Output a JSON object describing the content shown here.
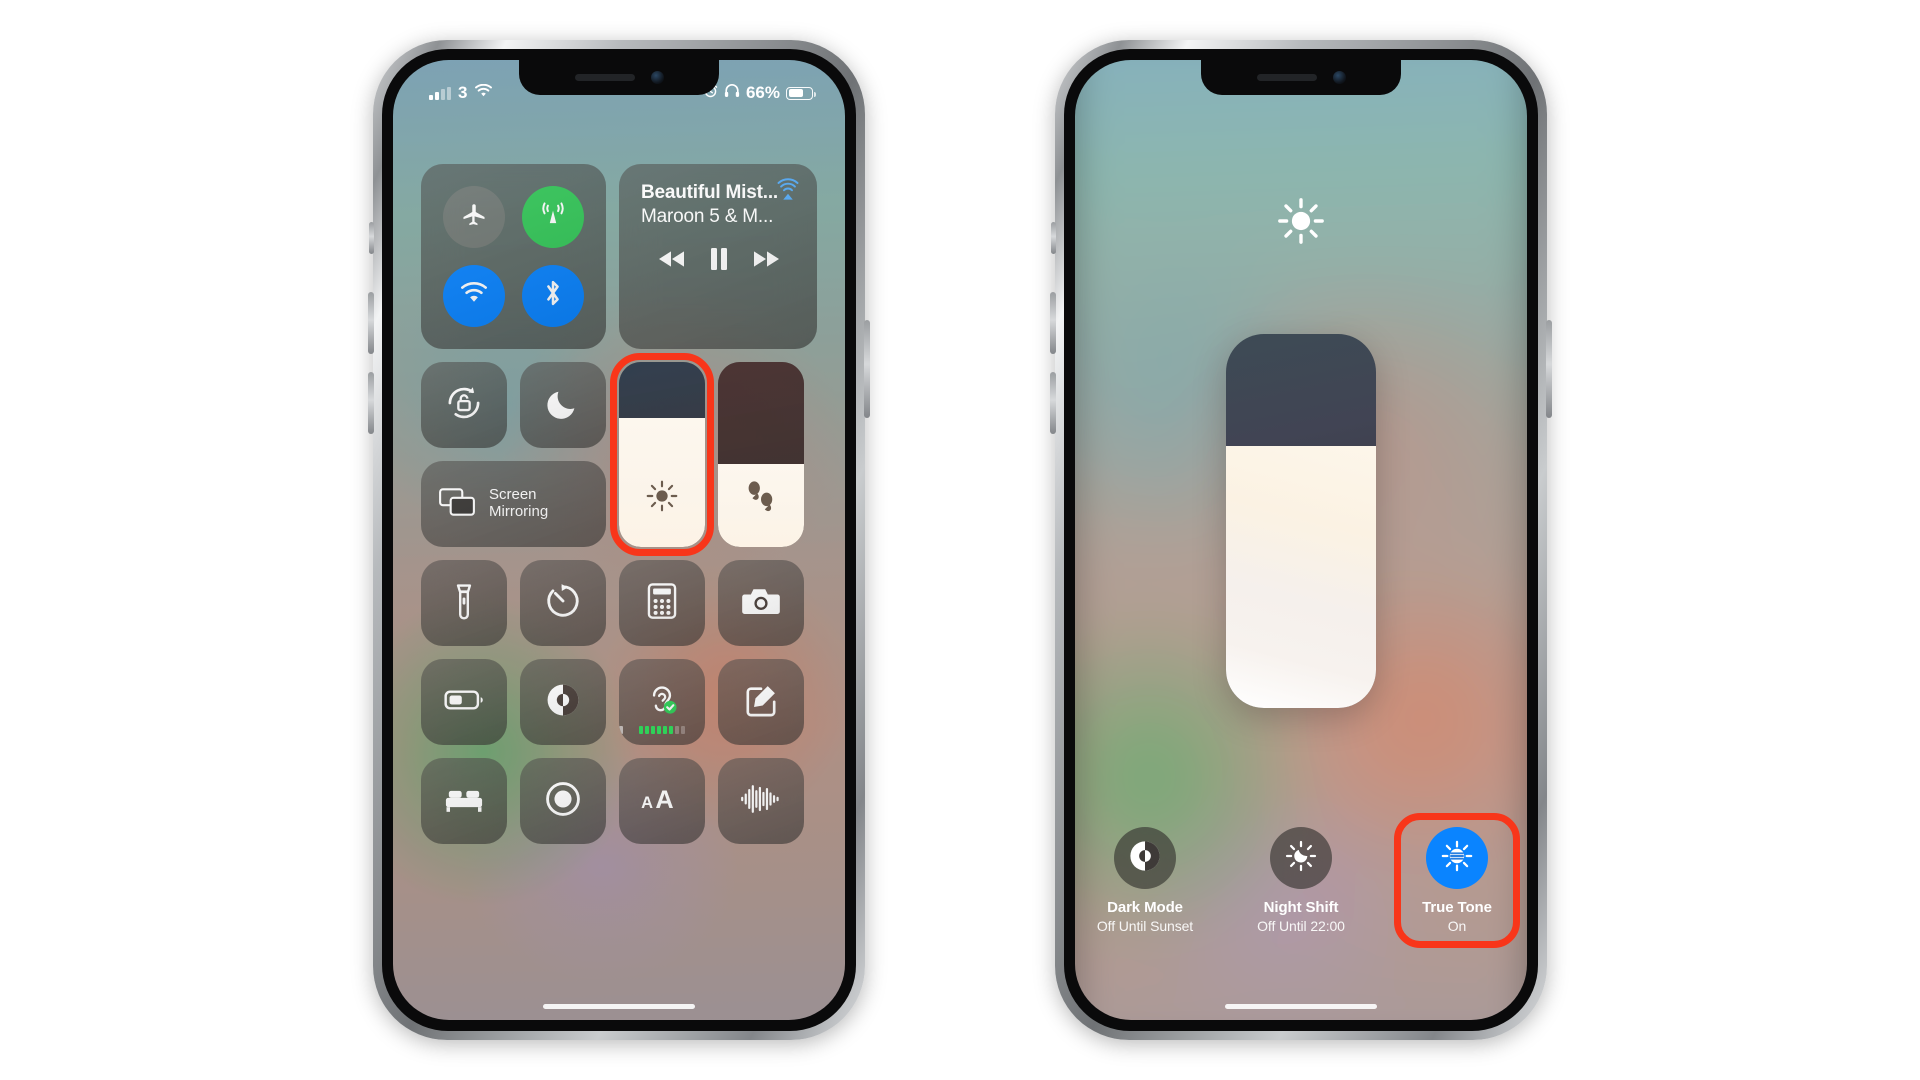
{
  "scene": {
    "description": "iOS Control Center brightness controls on two iPhone X screenshots",
    "accent_highlight_color": "#f8361a",
    "active_toggle_color": "#0a84ff"
  },
  "phone_left": {
    "status_bar": {
      "signal_icon": "cellular-bars-icon",
      "carrier_label": "3",
      "wifi_icon": "wifi-icon",
      "alarm_icon": "alarm-clock-icon",
      "headphones_icon": "headphones-icon",
      "battery_percent": "66%",
      "battery_icon": "battery-icon"
    },
    "connectivity": {
      "airplane": {
        "name": "Airplane Mode",
        "icon": "airplane-icon",
        "state": "off"
      },
      "cellular": {
        "name": "Cellular Data",
        "icon": "cellular-antenna-icon",
        "state": "on"
      },
      "wifi": {
        "name": "Wi-Fi",
        "icon": "wifi-icon",
        "state": "on"
      },
      "bluetooth": {
        "name": "Bluetooth",
        "icon": "bluetooth-icon",
        "state": "on"
      }
    },
    "now_playing": {
      "title": "Beautiful Mist...",
      "artist": "Maroon 5 & M...",
      "airplay_icon": "airplay-audio-icon",
      "rewind_icon": "rewind-icon",
      "pause_icon": "pause-icon",
      "forward_icon": "fast-forward-icon"
    },
    "controls": {
      "rotation_lock": {
        "label": "Rotation Lock",
        "icon": "rotation-lock-icon"
      },
      "do_not_disturb": {
        "label": "Do Not Disturb",
        "icon": "moon-icon"
      },
      "screen_mirroring": {
        "line1": "Screen",
        "line2": "Mirroring",
        "icon": "screen-mirroring-icon"
      },
      "brightness_slider": {
        "label": "Brightness",
        "icon": "sun-icon",
        "value_percent": 70,
        "highlighted": true
      },
      "volume_slider": {
        "label": "Volume",
        "icon": "airpods-icon",
        "value_percent": 45,
        "highlighted": false
      }
    },
    "icon_grid": [
      {
        "label": "Flashlight",
        "icon": "flashlight-icon"
      },
      {
        "label": "Timer",
        "icon": "timer-icon"
      },
      {
        "label": "Calculator",
        "icon": "calculator-icon"
      },
      {
        "label": "Camera",
        "icon": "camera-icon"
      },
      {
        "label": "Low Power Mode",
        "icon": "low-power-battery-icon"
      },
      {
        "label": "Dark Mode",
        "icon": "dark-mode-circle-icon"
      },
      {
        "label": "Hearing",
        "icon": "ear-hearing-icon"
      },
      {
        "label": "Notes",
        "icon": "notes-pencil-icon"
      },
      {
        "label": "Sleep",
        "icon": "bed-icon"
      },
      {
        "label": "Screen Recording",
        "icon": "screen-record-icon"
      },
      {
        "label": "Text Size",
        "icon": "text-size-aa-icon"
      },
      {
        "label": "Sound Recognition",
        "icon": "sound-waveform-icon"
      }
    ],
    "hearing_meter_levels": [
      1,
      1,
      1,
      1,
      1,
      1,
      2,
      3,
      3
    ]
  },
  "phone_right": {
    "brightness_detail": {
      "top_icon": "sun-icon",
      "slider_label": "Brightness",
      "value_percent": 70
    },
    "toggles": [
      {
        "name": "Dark Mode",
        "state": "Off Until Sunset",
        "icon": "dark-mode-circle-icon",
        "active": false,
        "highlighted": false
      },
      {
        "name": "Night Shift",
        "state": "Off Until 22:00",
        "icon": "night-shift-icon",
        "active": false,
        "highlighted": false
      },
      {
        "name": "True Tone",
        "state": "On",
        "icon": "true-tone-icon",
        "active": true,
        "highlighted": true
      }
    ]
  }
}
